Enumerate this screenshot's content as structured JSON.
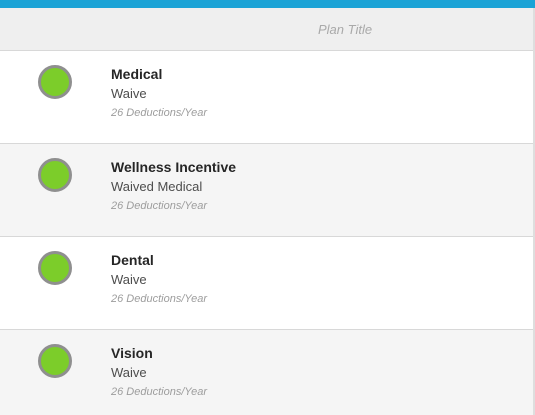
{
  "header": {
    "title": "Plan Title"
  },
  "plans": [
    {
      "name": "Medical",
      "status": "Waive",
      "deductions": "26 Deductions/Year",
      "status_color": "#7ccd2a"
    },
    {
      "name": "Wellness Incentive",
      "status": "Waived Medical",
      "deductions": "26 Deductions/Year",
      "status_color": "#7ccd2a"
    },
    {
      "name": "Dental",
      "status": "Waive",
      "deductions": "26 Deductions/Year",
      "status_color": "#7ccd2a"
    },
    {
      "name": "Vision",
      "status": "Waive",
      "deductions": "26 Deductions/Year",
      "status_color": "#7ccd2a"
    }
  ],
  "colors": {
    "accent": "#1ba3d6",
    "status_ok": "#7ccd2a"
  }
}
